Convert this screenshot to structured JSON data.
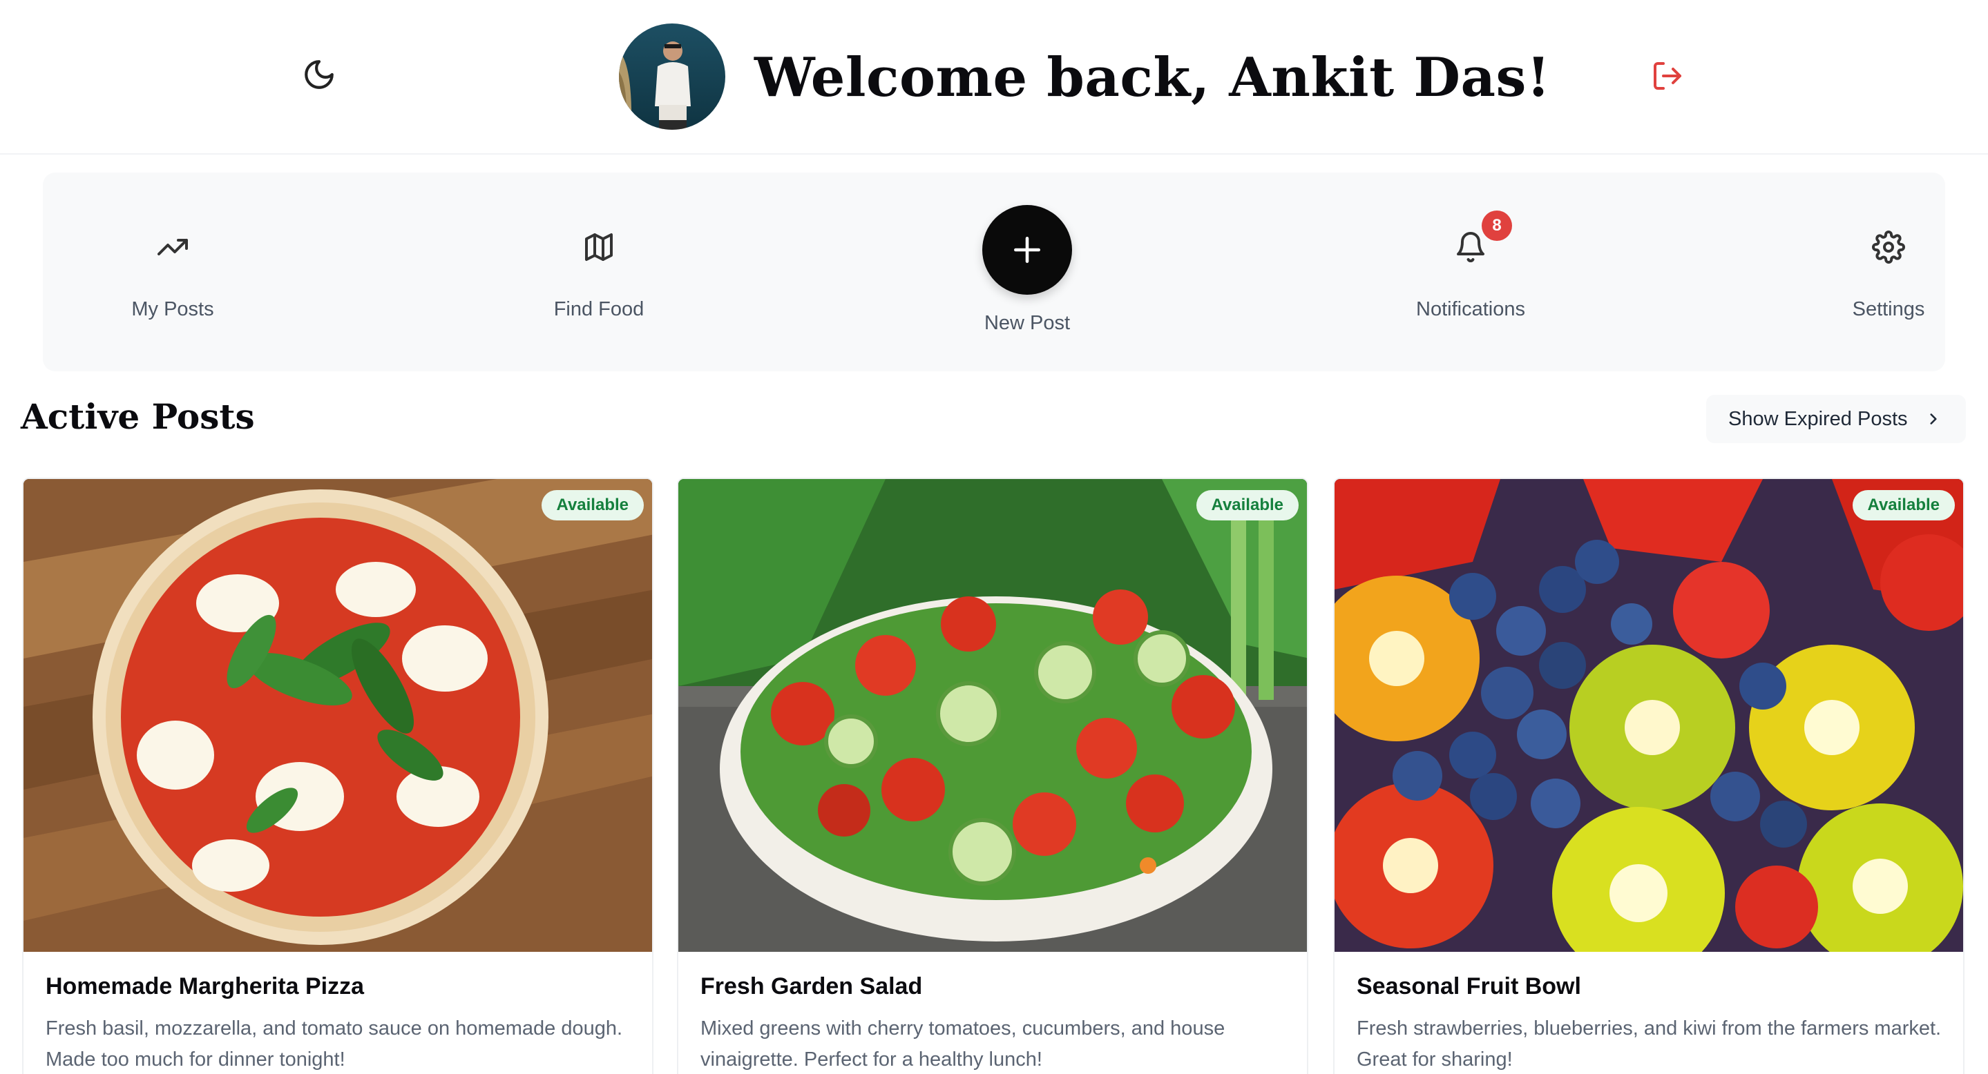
{
  "header": {
    "welcome": "Welcome back, Ankit Das!",
    "theme_icon": "moon-icon",
    "logout_icon": "logout-icon",
    "logout_color": "#e0413e"
  },
  "nav": {
    "items": [
      {
        "label": "My Posts",
        "icon": "trending-up-icon"
      },
      {
        "label": "Find Food",
        "icon": "map-icon"
      },
      {
        "label": "New Post",
        "icon": "plus-icon"
      },
      {
        "label": "Notifications",
        "icon": "bell-icon",
        "badge": "8"
      },
      {
        "label": "Settings",
        "icon": "gear-icon"
      }
    ]
  },
  "section": {
    "title": "Active Posts",
    "expired_button": "Show Expired Posts"
  },
  "posts": [
    {
      "status": "Available",
      "title": "Homemade Margherita Pizza",
      "description": "Fresh basil, mozzarella, and tomato sauce on homemade dough. Made too much for dinner tonight!"
    },
    {
      "status": "Available",
      "title": "Fresh Garden Salad",
      "description": "Mixed greens with cherry tomatoes, cucumbers, and house vinaigrette. Perfect for a healthy lunch!"
    },
    {
      "status": "Available",
      "title": "Seasonal Fruit Bowl",
      "description": "Fresh strawberries, blueberries, and kiwi from the farmers market. Great for sharing!"
    }
  ],
  "colors": {
    "accent_black": "#0a0a0a",
    "badge_red": "#e0413e",
    "available_green": "#15803d",
    "available_bg": "#e8f7ec",
    "nav_bg": "#f8f9fa"
  }
}
